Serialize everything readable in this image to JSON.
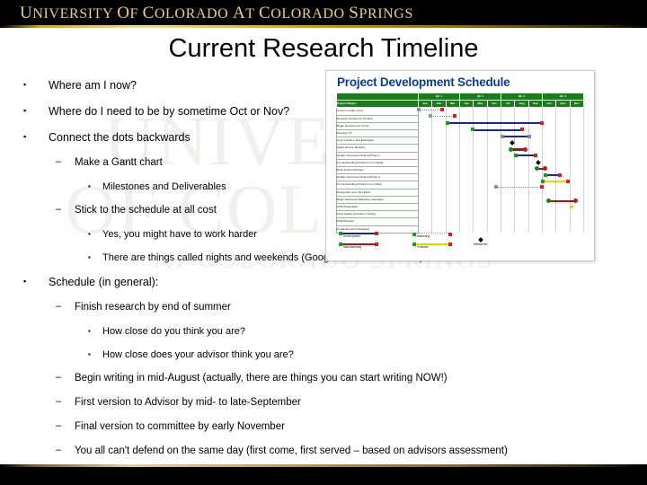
{
  "banner": {
    "institution": "UNIVERSITY OF COLORADO AT COLORADO SPRINGS"
  },
  "watermark": {
    "line1": "UNIVERSITY",
    "line2": "OF COLORADO",
    "line3": "AT COLORADO SPRINGS"
  },
  "slide": {
    "title": "Current Research Timeline"
  },
  "bullets": [
    {
      "level": 1,
      "mark": "▪",
      "text": "Where am I now?"
    },
    {
      "level": 1,
      "mark": "▪",
      "text": "Where do I need to be by sometime Oct or Nov?"
    },
    {
      "level": 1,
      "mark": "▪",
      "text": "Connect the dots backwards"
    },
    {
      "level": 2,
      "mark": "–",
      "text": "Make a Gantt chart"
    },
    {
      "level": 3,
      "mark": "▪",
      "text": "Milestones and Deliverables"
    },
    {
      "level": 2,
      "mark": "–",
      "text": "Stick to the schedule at all cost"
    },
    {
      "level": 3,
      "mark": "▪",
      "text": "Yes, you might have to work harder"
    },
    {
      "level": 3,
      "mark": "▪",
      "text": "There are things called nights and weekends (Google them for more info)"
    },
    {
      "level": 1,
      "mark": "▪",
      "text": "Schedule (in general):"
    },
    {
      "level": 2,
      "mark": "–",
      "text": "Finish research by end of summer"
    },
    {
      "level": 3,
      "mark": "▪",
      "text": "How close do you think you are?"
    },
    {
      "level": 3,
      "mark": "▪",
      "text": "How close does your advisor think you are?"
    },
    {
      "level": 2,
      "mark": "–",
      "text": "Begin writing in mid-August (actually, there are things you can start writing NOW!)"
    },
    {
      "level": 2,
      "mark": "–",
      "text": "First version to Advisor by mid- to late-September"
    },
    {
      "level": 2,
      "mark": "–",
      "text": "Final version to committee by early November"
    },
    {
      "level": 2,
      "mark": "–",
      "text": "You all can't defend on the same day (first come, first served – based on advisors assessment)"
    }
  ],
  "chart_data": {
    "type": "table",
    "title": "Project Development Schedule",
    "stage_column_header": "Project Stages",
    "quarters": [
      "Qtr 1",
      "Qtr 2",
      "Qtr 3",
      "Qtr 4"
    ],
    "months": [
      "Jan",
      "Feb",
      "Mar",
      "Apr",
      "May",
      "Jun",
      "Jul",
      "Aug",
      "Sep",
      "Oct",
      "Nov",
      "Dec"
    ],
    "tasks": [
      {
        "name": "Custom market need",
        "start": 0.05,
        "end": 1.85,
        "style": "dotted-thin"
      },
      {
        "name": "Develop Concept for Product",
        "start": 0.9,
        "end": 2.75,
        "style": "dotted-thin"
      },
      {
        "name": "Begin Development Cycle",
        "start": 2.1,
        "end": 9.05,
        "style": "navy"
      },
      {
        "name": "Develop 3.0",
        "start": 3.95,
        "end": 7.6,
        "style": "navy"
      },
      {
        "name": "User Interface Test Evaluation",
        "start": 6.1,
        "end": 8.1,
        "style": "navy-arrows"
      },
      {
        "name": "Alpha Version Release",
        "start": 6.85,
        "end": 6.85,
        "style": "milestone"
      },
      {
        "name": "Quality Assurance Testing Phase 1",
        "start": 6.7,
        "end": 7.8,
        "style": "red"
      },
      {
        "name": "Fix Outstanding Problems from Alpha",
        "start": 7.05,
        "end": 8.55,
        "style": "navy"
      },
      {
        "name": "Beta Version Release",
        "start": 8.7,
        "end": 8.7,
        "style": "milestone"
      },
      {
        "name": "Quality Assurance Testing Phase 2",
        "start": 8.55,
        "end": 9.25,
        "style": "red"
      },
      {
        "name": "Fix Outstanding Problems from Beta",
        "start": 9.15,
        "end": 10.35,
        "style": "navy"
      },
      {
        "name": "Design Box and CD Labels",
        "start": 8.95,
        "end": 10.9,
        "style": "yellow"
      },
      {
        "name": "Begin Advanced Marketing Campaign",
        "start": 5.6,
        "end": 9.0,
        "style": "dotted-thin"
      },
      {
        "name": "PCB Preparation",
        "start": 0,
        "end": 0,
        "style": "none"
      },
      {
        "name": "Final Quality Assurance Testing",
        "start": 9.4,
        "end": 11.4,
        "style": "red"
      },
      {
        "name": "PCB Release",
        "start": 11.1,
        "end": 11.1,
        "style": "star"
      },
      {
        "name": "Production and Packaging",
        "start": 0,
        "end": 0,
        "style": "none"
      }
    ],
    "legend": [
      {
        "label": "Development",
        "color": "#1b2a80",
        "shape": "bar"
      },
      {
        "label": "Manufacturing",
        "color": "#a81414",
        "shape": "bar"
      },
      {
        "label": "Marketing",
        "color": "#9a9a9a",
        "shape": "dotted"
      },
      {
        "label": "Forecast",
        "color": "#e8d200",
        "shape": "bar"
      },
      {
        "label": "Milestones",
        "color": "#000000",
        "shape": "diamond"
      }
    ]
  }
}
